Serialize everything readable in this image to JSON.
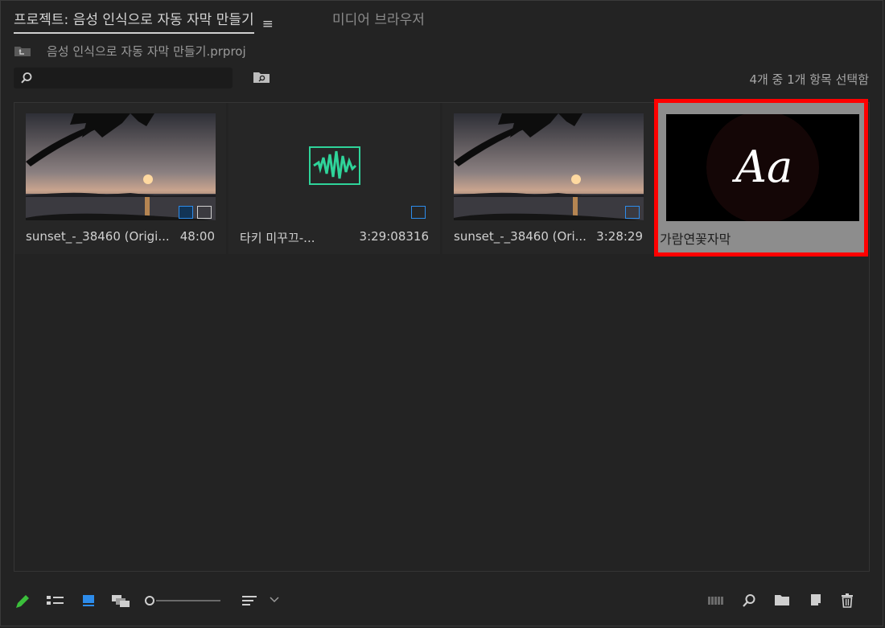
{
  "tabs": {
    "project_title": "프로젝트: 음성 인식으로 자동 자막 만들기",
    "menu_glyph": "≡",
    "media_browser": "미디어 브라우저"
  },
  "path": {
    "filename": "음성 인식으로 자동 자막 만들기.prproj"
  },
  "search": {
    "value": "",
    "placeholder": ""
  },
  "selection_count": "4개 중 1개 항목 선택함",
  "items": [
    {
      "name": "sunset_-_38460 (Origi...",
      "duration": "48:00",
      "type": "video"
    },
    {
      "name": "타키 미꾸끄-...",
      "duration": "3:29:08316",
      "type": "audio"
    },
    {
      "name": "sunset_-_38460 (Ori...",
      "duration": "3:28:29",
      "type": "sequence"
    },
    {
      "name": "가람연꽃자막",
      "duration": "",
      "type": "caption",
      "preview_text": "Aa",
      "selected": true
    }
  ],
  "colors": {
    "accent_blue": "#2d8ceb",
    "audio_green": "#2fd49a",
    "selection": "#ff0000",
    "pencil": "#3bbf3b"
  }
}
